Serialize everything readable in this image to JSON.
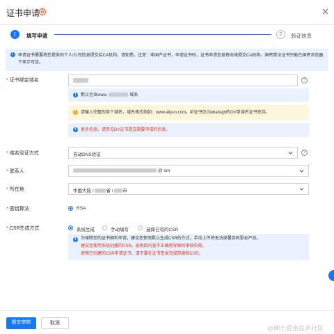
{
  "header": {
    "title": "证书申请"
  },
  "steps": [
    {
      "num": "1",
      "label": "填写申请"
    },
    {
      "num": "2",
      "label": "验证信息"
    }
  ],
  "banner": {
    "text": "申请证书需要将您提供的个人/公司信息提交给CA机构，请知悉。注意：非国产证书，申请证书时，证书申请信息将出境提交CA机构。国密算法证书只能在国密浏览器下显示可信。"
  },
  "domain": {
    "label": "证书绑定域名",
    "default_note_prefix": "默认包含www.",
    "default_note_suffix": "域名",
    "warn_text": "请输入完整的单个域名，域名格式例如：www.aliyun.com。IP证书仅Globalsign的OV单域名证书支持。",
    "link_text": "更多信息，请参见DV证书提交需要申请的信息。"
  },
  "verify": {
    "label": "域名验证方式",
    "value": "自动DNS验证"
  },
  "contact": {
    "label": "联系人",
    "value_tail": "@  om"
  },
  "location": {
    "label": "所在地",
    "p1": "中国大陆 /",
    "p2": "省 /",
    "p3": "市"
  },
  "algo": {
    "label": "密钥算法",
    "option": "RSA"
  },
  "csr": {
    "label": "CSR生成方式",
    "options": [
      "系统生成",
      "手动填写",
      "选择已有的CSR"
    ],
    "note1": "为保障您的证书顺利申请，建议您使用默认生成CSR的方式，手动上传将无法部署到阿里云产品。",
    "note2": "建议您使用系统创建的CSR，避免因内容不正确而导致的审核失败。",
    "note3": "使用已创建的CSR申请证书，请不要在证书签发完成前删除CSR。"
  },
  "footer": {
    "submit": "提交审核",
    "cancel": "取消",
    "watermark": "@稀土掘金技术社区"
  },
  "colors": {
    "accent": "#1677ff",
    "warn_bg": "#fdf6dc",
    "info_bg": "#e8f1fd",
    "error": "#e5311b"
  }
}
